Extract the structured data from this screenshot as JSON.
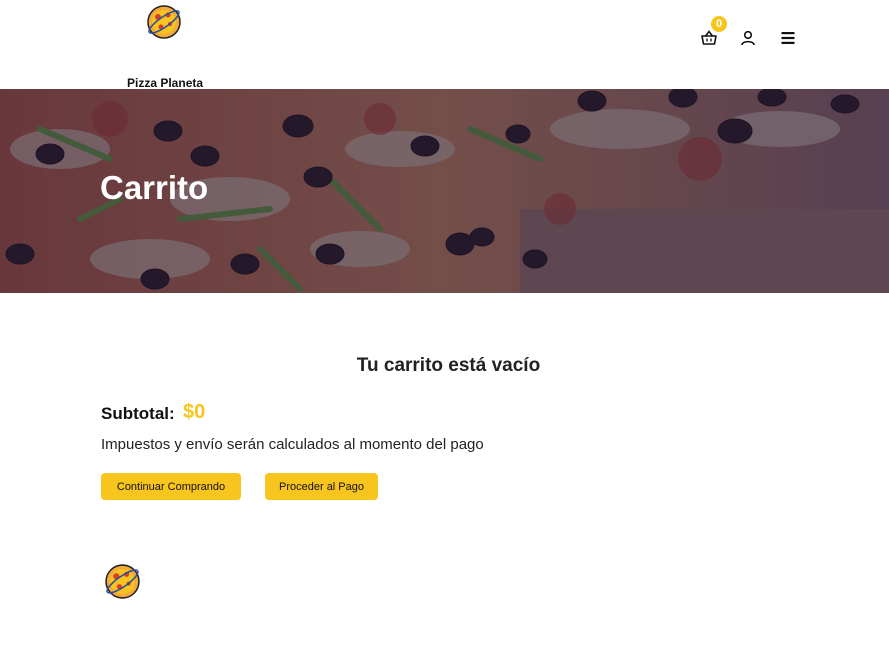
{
  "header": {
    "brand": "Pizza Planeta",
    "cart_count": "0"
  },
  "hero": {
    "title": "Carrito"
  },
  "cart": {
    "empty_message": "Tu carrito está vacío",
    "subtotal_label": "Subtotal:",
    "subtotal_value": "$0",
    "tax_note": "Impuestos y envío serán calculados al momento del pago",
    "continue_label": "Continuar Comprando",
    "checkout_label": "Proceder al Pago"
  },
  "colors": {
    "accent": "#f7c51e",
    "hero_overlay": "#2d1e3c"
  },
  "icons": [
    "pizza-planet-logo",
    "basket-icon",
    "user-icon",
    "hamburger-menu-icon"
  ]
}
